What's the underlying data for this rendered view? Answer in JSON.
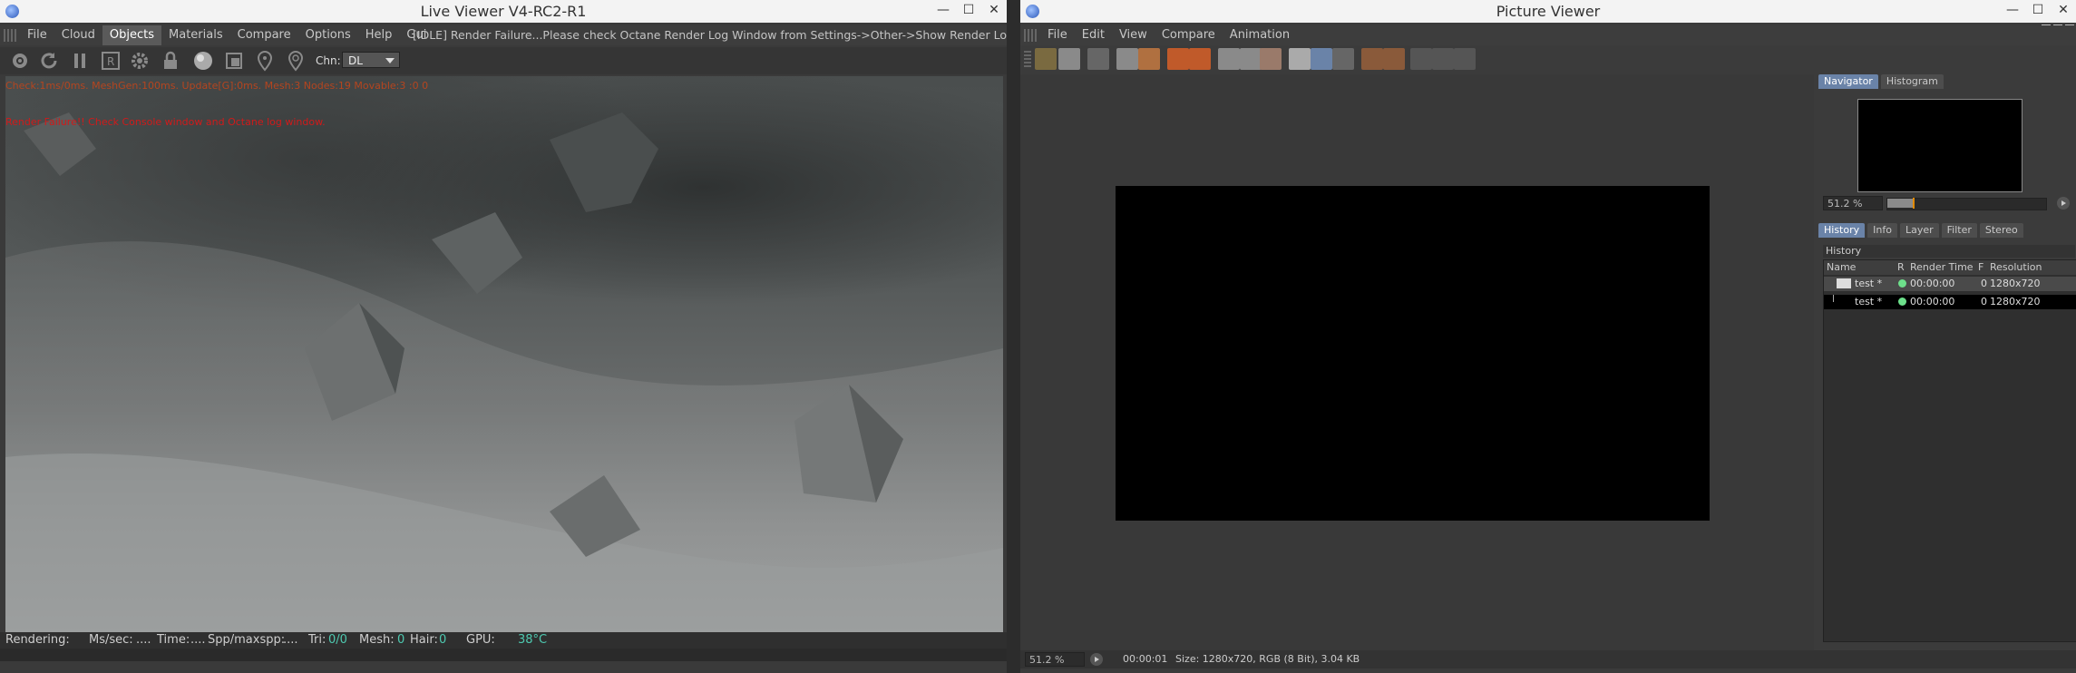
{
  "live_viewer": {
    "title": "Live Viewer V4-RC2-R1",
    "menu": [
      "File",
      "Cloud",
      "Objects",
      "Materials",
      "Compare",
      "Options",
      "Help",
      "Gui"
    ],
    "active_menu": "Objects",
    "status_message": "[IDLE] Render Failure...Please check Octane Render Log Window from Settings->Other->Show Render Lo",
    "channel_label": "Chn:",
    "channel_value": "DL",
    "stats_line": "Check:1ms/0ms. MeshGen:100ms. Update[G]:0ms. Mesh:3 Nodes:19 Movable:3 :0 0",
    "render_error": "Render Failure!! Check Console window and Octane log window.",
    "status_bar": {
      "rendering": "Rendering:",
      "mssec_label": "Ms/sec:",
      "mssec_value": "....",
      "time_label": "Time:",
      "time_value": "....",
      "spp_label": "Spp/maxspp:",
      "spp_value": "....",
      "tri_label": "Tri:",
      "tri_value": "0/0",
      "mesh_label": "Mesh:",
      "mesh_value": "0",
      "hair_label": "Hair:",
      "hair_value": "0",
      "gpu_label": "GPU:",
      "gpu_value": "38°C"
    }
  },
  "picture_viewer": {
    "title": "Picture Viewer",
    "menu": [
      "File",
      "Edit",
      "View",
      "Compare",
      "Animation"
    ],
    "top_tabs": [
      "Navigator",
      "Histogram"
    ],
    "nav_zoom": "51.2 %",
    "bottom_tabs": [
      "History",
      "Info",
      "Layer",
      "Filter",
      "Stereo"
    ],
    "history_label": "History",
    "columns": [
      "Name",
      "R",
      "Render Time",
      "F",
      "Resolution"
    ],
    "rows": [
      {
        "name": "test *",
        "time": "00:00:00",
        "f": "0",
        "res": "1280x720"
      },
      {
        "name": "test *",
        "time": "00:00:00",
        "f": "0",
        "res": "1280x720"
      }
    ],
    "status": {
      "zoom": "51.2 %",
      "time": "00:00:01",
      "info": "Size: 1280x720, RGB (8 Bit), 3.04 KB"
    }
  },
  "colors": {
    "accent_blue": "#6a83a8",
    "error_red": "#d11a1a",
    "stats_orange": "#b5451f",
    "status_cyan": "#4ec9b0",
    "render_dot_green": "#6de08b"
  }
}
